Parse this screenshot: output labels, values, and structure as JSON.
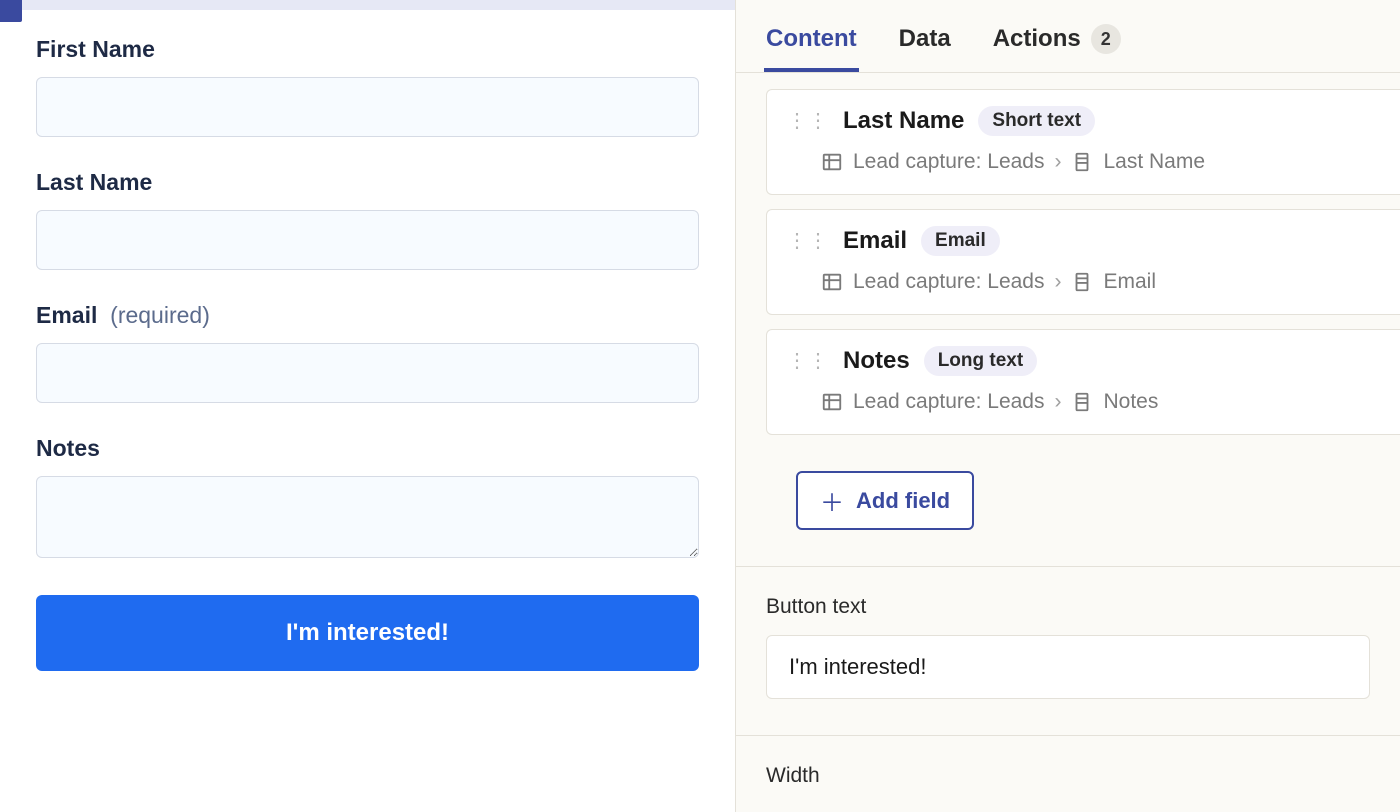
{
  "form": {
    "fields": [
      {
        "label": "First Name",
        "required": false,
        "multiline": false
      },
      {
        "label": "Last Name",
        "required": false,
        "multiline": false
      },
      {
        "label": "Email",
        "required": true,
        "multiline": false
      },
      {
        "label": "Notes",
        "required": false,
        "multiline": true
      }
    ],
    "required_suffix": "(required)",
    "submit_label": "I'm interested!"
  },
  "tabs": {
    "content": "Content",
    "data": "Data",
    "actions": "Actions",
    "actions_count": "2",
    "active": "content"
  },
  "field_cards": [
    {
      "name": "Last Name",
      "type": "Short text",
      "source": "Lead capture: Leads",
      "column": "Last Name"
    },
    {
      "name": "Email",
      "type": "Email",
      "source": "Lead capture: Leads",
      "column": "Email"
    },
    {
      "name": "Notes",
      "type": "Long text",
      "source": "Lead capture: Leads",
      "column": "Notes"
    }
  ],
  "add_field_label": "Add field",
  "button_text_section": {
    "label": "Button text",
    "value": "I'm interested!"
  },
  "width_section": {
    "label": "Width"
  }
}
